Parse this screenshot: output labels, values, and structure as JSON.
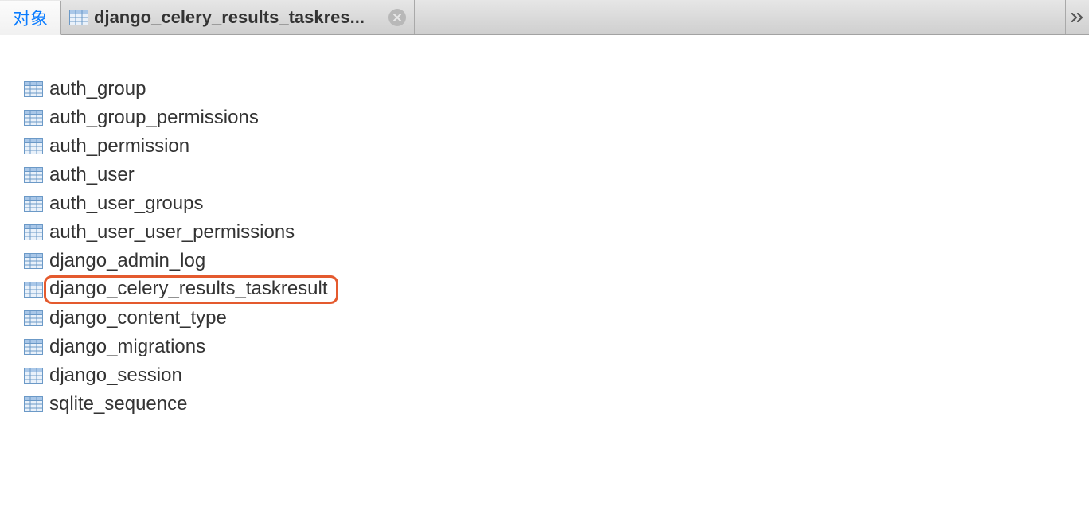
{
  "tabs": {
    "first_label": "对象",
    "file_label": "django_celery_results_taskres..."
  },
  "tables": [
    {
      "name": "auth_group",
      "highlighted": false
    },
    {
      "name": "auth_group_permissions",
      "highlighted": false
    },
    {
      "name": "auth_permission",
      "highlighted": false
    },
    {
      "name": "auth_user",
      "highlighted": false
    },
    {
      "name": "auth_user_groups",
      "highlighted": false
    },
    {
      "name": "auth_user_user_permissions",
      "highlighted": false
    },
    {
      "name": "django_admin_log",
      "highlighted": false
    },
    {
      "name": "django_celery_results_taskresult",
      "highlighted": true
    },
    {
      "name": "django_content_type",
      "highlighted": false
    },
    {
      "name": "django_migrations",
      "highlighted": false
    },
    {
      "name": "django_session",
      "highlighted": false
    },
    {
      "name": "sqlite_sequence",
      "highlighted": false
    }
  ]
}
